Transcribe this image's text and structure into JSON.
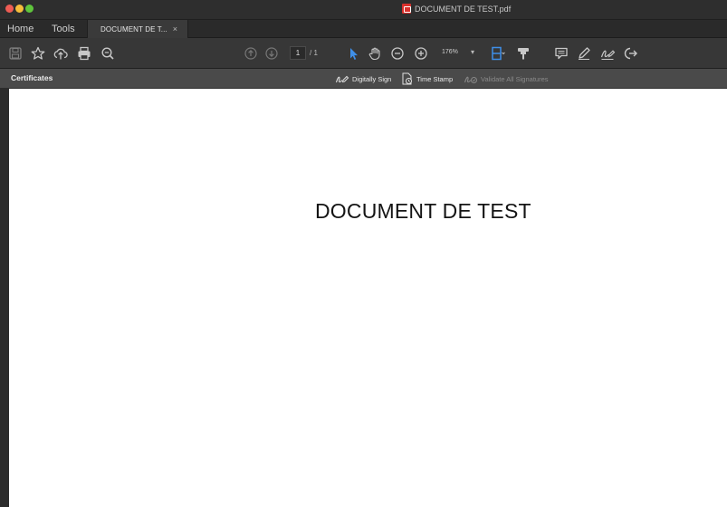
{
  "window": {
    "title": "DOCUMENT DE TEST.pdf",
    "traffic_colors": {
      "close": "#ee5c54",
      "minimize": "#f6bd3b",
      "zoom": "#5fc53c"
    }
  },
  "tabs": {
    "home": "Home",
    "tools": "Tools",
    "document_tab": "DOCUMENT DE T...",
    "close_glyph": "×"
  },
  "toolbar": {
    "current_page": "1",
    "total_pages": "/ 1",
    "zoom": "176%",
    "zoom_caret": "▾",
    "accent_color": "#3f8fe8",
    "icons": [
      "save-icon",
      "bookmark-star-icon",
      "upload-cloud-icon",
      "print-icon",
      "search-zoom-icon",
      "previous-page-icon",
      "next-page-icon",
      "select-cursor-icon",
      "hand-pan-icon",
      "zoom-out-icon",
      "zoom-in-icon",
      "page-fit-icon",
      "highlight-marker-icon",
      "comment-icon",
      "pen-icon",
      "sign-icon",
      "share-icon"
    ]
  },
  "certificates": {
    "title": "Certificates",
    "digitally_sign": "Digitally Sign",
    "time_stamp": "Time Stamp",
    "validate_all": "Validate All Signatures"
  },
  "document": {
    "heading": "DOCUMENT DE TEST"
  }
}
